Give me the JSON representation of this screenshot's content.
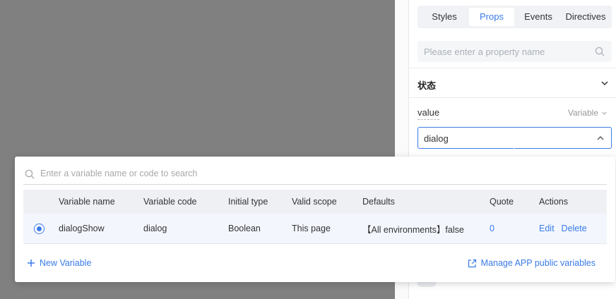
{
  "tabs": [
    "Styles",
    "Props",
    "Events",
    "Directives"
  ],
  "active_tab": "Props",
  "property_search": {
    "placeholder": "Please enter a property name"
  },
  "section": {
    "title": "状态"
  },
  "field": {
    "label": "value",
    "mode": "Variable",
    "selected_value": "dialog"
  },
  "popup": {
    "search_placeholder": "Enter a variable name or code to search",
    "columns": {
      "name": "Variable name",
      "code": "Variable code",
      "type": "Initial type",
      "scope": "Valid scope",
      "defaults": "Defaults",
      "quote": "Quote",
      "actions": "Actions"
    },
    "rows": [
      {
        "selected": true,
        "name": "dialogShow",
        "code": "dialog",
        "type": "Boolean",
        "scope": "This page",
        "defaults": "【All environments】false",
        "quote": "0",
        "edit": "Edit",
        "delete": "Delete"
      }
    ],
    "new_variable": "New Variable",
    "manage_public": "Manage APP public variables"
  },
  "colors": {
    "accent": "#3a7be8",
    "canvas": "#808080",
    "row_selected": "#f3f6fd",
    "header_bg": "#eef0f4"
  }
}
